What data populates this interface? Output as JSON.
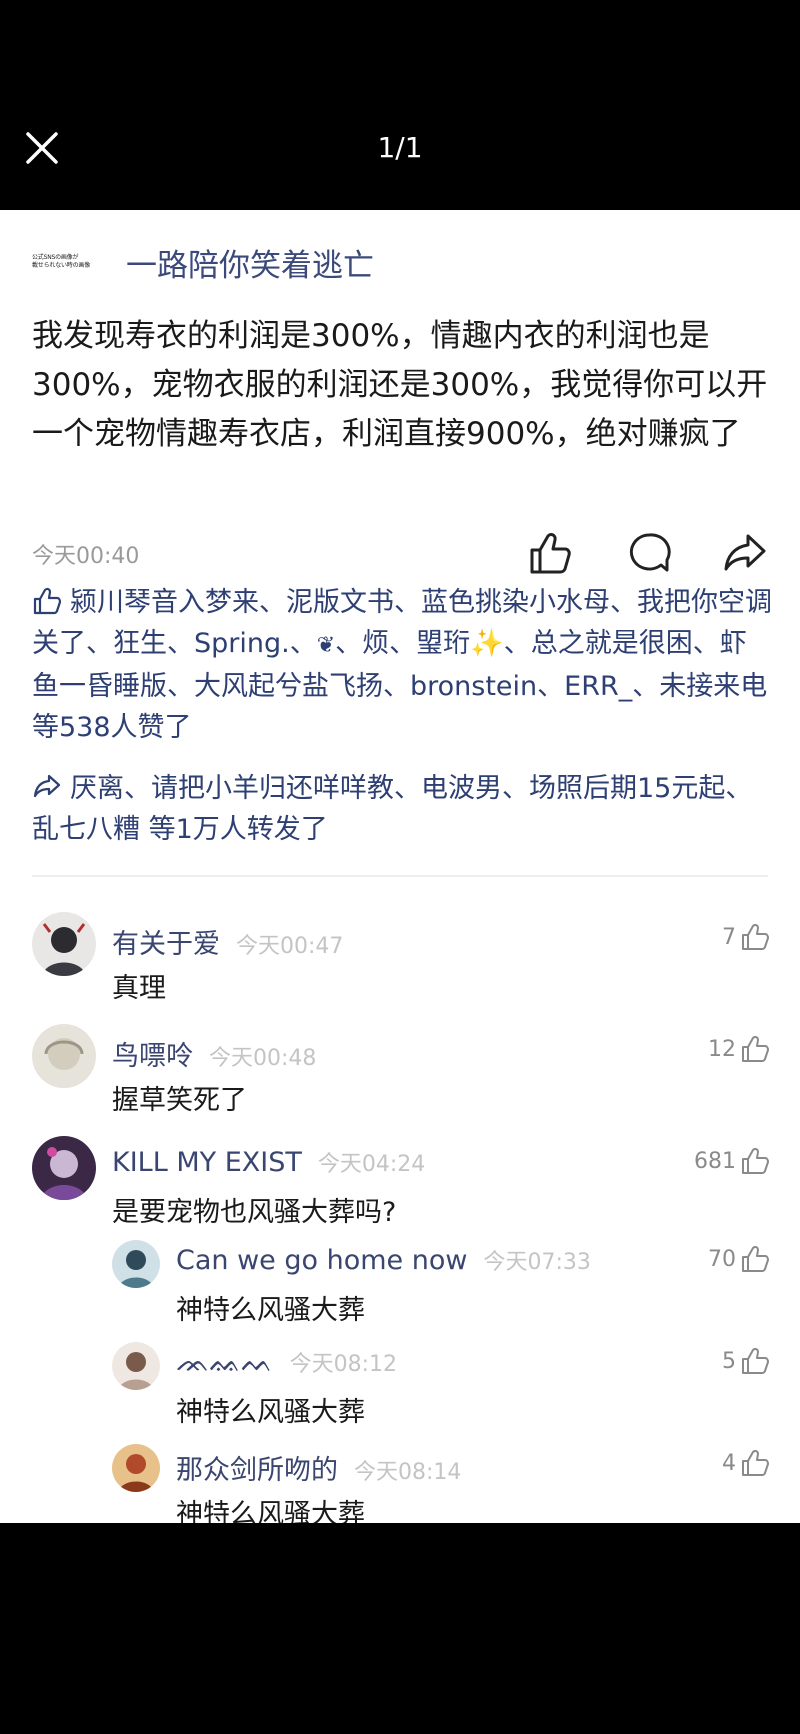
{
  "viewer": {
    "page_counter": "1/1",
    "close_icon": "close-icon"
  },
  "post": {
    "author_badge_lines": [
      "公式SNSの画像が",
      "載せられない時の画像"
    ],
    "author_name": "一路陪你笑着逃亡",
    "text": "我发现寿衣的利润是300%，情趣内衣的利润也是300%，宠物衣服的利润还是300%，我觉得你可以开一个宠物情趣寿衣店，利润直接900%，绝对赚疯了",
    "time": "今天00:40",
    "actions": [
      "like-icon",
      "comment-icon",
      "share-icon"
    ]
  },
  "likes": {
    "names": [
      "颍川琴音入梦来",
      "泥版文书",
      "蓝色挑染小水母",
      "我把你空调关了",
      "狂生",
      "Spring.",
      "❦",
      "烦",
      "琞珩",
      "总之就是很困",
      "虾鱼一昏睡版",
      "大风起兮盐飞扬",
      "bronstein",
      "ERR_",
      "未接来电"
    ],
    "sparkle": "✨",
    "summary": "等538人赞了"
  },
  "shares": {
    "names": [
      "厌离",
      "请把小羊归还咩咩教",
      "电波男",
      "场照后期15元起",
      "乱七八糟"
    ],
    "summary": "等1万人转发了"
  },
  "comments": [
    {
      "name": "有关于爱",
      "time": "今天00:47",
      "text": "真理",
      "likes": "7",
      "avatar_color": "#9a9aa4"
    },
    {
      "name": "鸟嘌呤",
      "time": "今天00:48",
      "text": "握草笑死了",
      "likes": "12",
      "avatar_color": "#d8d4c8"
    },
    {
      "name": "KILL MY EXIST",
      "time": "今天04:24",
      "text": "是要宠物也风骚大葬吗?",
      "likes": "681",
      "avatar_color": "#5a3a6a"
    }
  ],
  "replies": [
    {
      "name": "Can we go home now",
      "time": "今天07:33",
      "text": "神特么风骚大葬",
      "likes": "70",
      "avatar_color": "#5a7a8a"
    },
    {
      "name": "ᨏᨐᨓ",
      "time": "今天08:12",
      "text": "神特么风骚大葬",
      "likes": "5",
      "avatar_color": "#b8a090"
    },
    {
      "name": "那众剑所吻的",
      "time": "今天08:14",
      "text": "神特么风骚大葬",
      "likes": "4",
      "avatar_color": "#b04a2a"
    }
  ]
}
